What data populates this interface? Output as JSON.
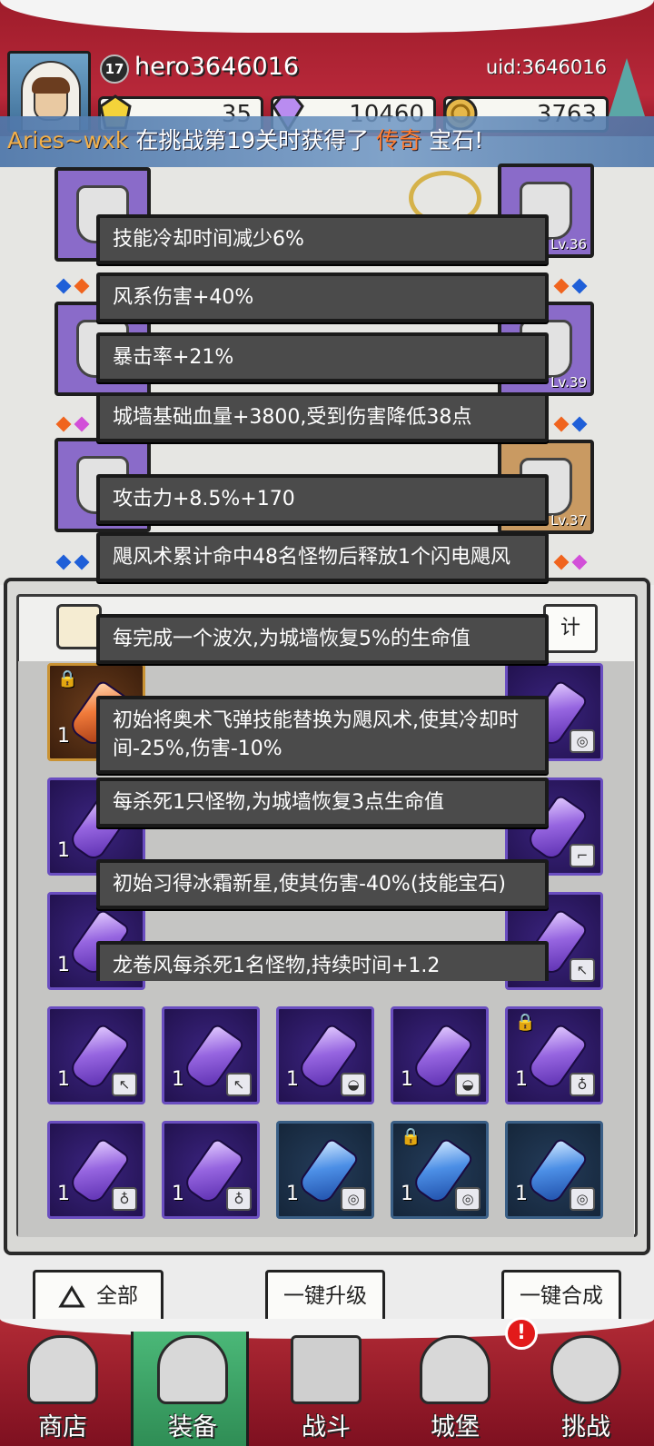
{
  "player": {
    "level": "17",
    "name": "hero3646016",
    "uid": "uid:3646016"
  },
  "resources": {
    "gold_stones": "35",
    "diamonds": "10460",
    "coins": "3763"
  },
  "notice": {
    "who": "Aries~wxk",
    "mid": " 在挑战第19关时获得了 ",
    "rarity": "传奇",
    "end": " 宝石!"
  },
  "equipment": {
    "slot_lv_r1": "Lv.36",
    "slot_lv_r2": "Lv.39",
    "slot_lv_r3": "Lv.37"
  },
  "inventory": {
    "right_tab_label": "计"
  },
  "tooltip": {
    "lines": [
      "技能冷却时间减少6%",
      "风系伤害+40%",
      "暴击率+21%",
      "城墙基础血量+3800,受到伤害降低38点",
      "攻击力+8.5%+170",
      "飓风术累计命中48名怪物后释放1个闪电飓风",
      "每完成一个波次,为城墙恢复5%的生命值",
      "初始将奥术飞弹技能替换为飓风术,使其冷却时间-25%,伤害-10%",
      "每杀死1只怪物,为城墙恢复3点生命值",
      "初始习得冰霜新星,使其伤害-40%(技能宝石)",
      "龙卷风每杀死1名怪物,持续时间+1.2"
    ]
  },
  "items": {
    "qty": "1"
  },
  "buttons": {
    "all": "全部",
    "upgrade_all": "一键升级",
    "merge_all": "一键合成"
  },
  "nav": {
    "shop": "商店",
    "equip": "装备",
    "battle": "战斗",
    "castle": "城堡",
    "challenge": "挑战",
    "alert": "!"
  },
  "colors": {
    "header_red": "#b8283a",
    "legendary": "#ff7e33",
    "purple_gem": "#9665e0",
    "blue_gem": "#4c8fe6",
    "active_tab": "#3fa466"
  }
}
